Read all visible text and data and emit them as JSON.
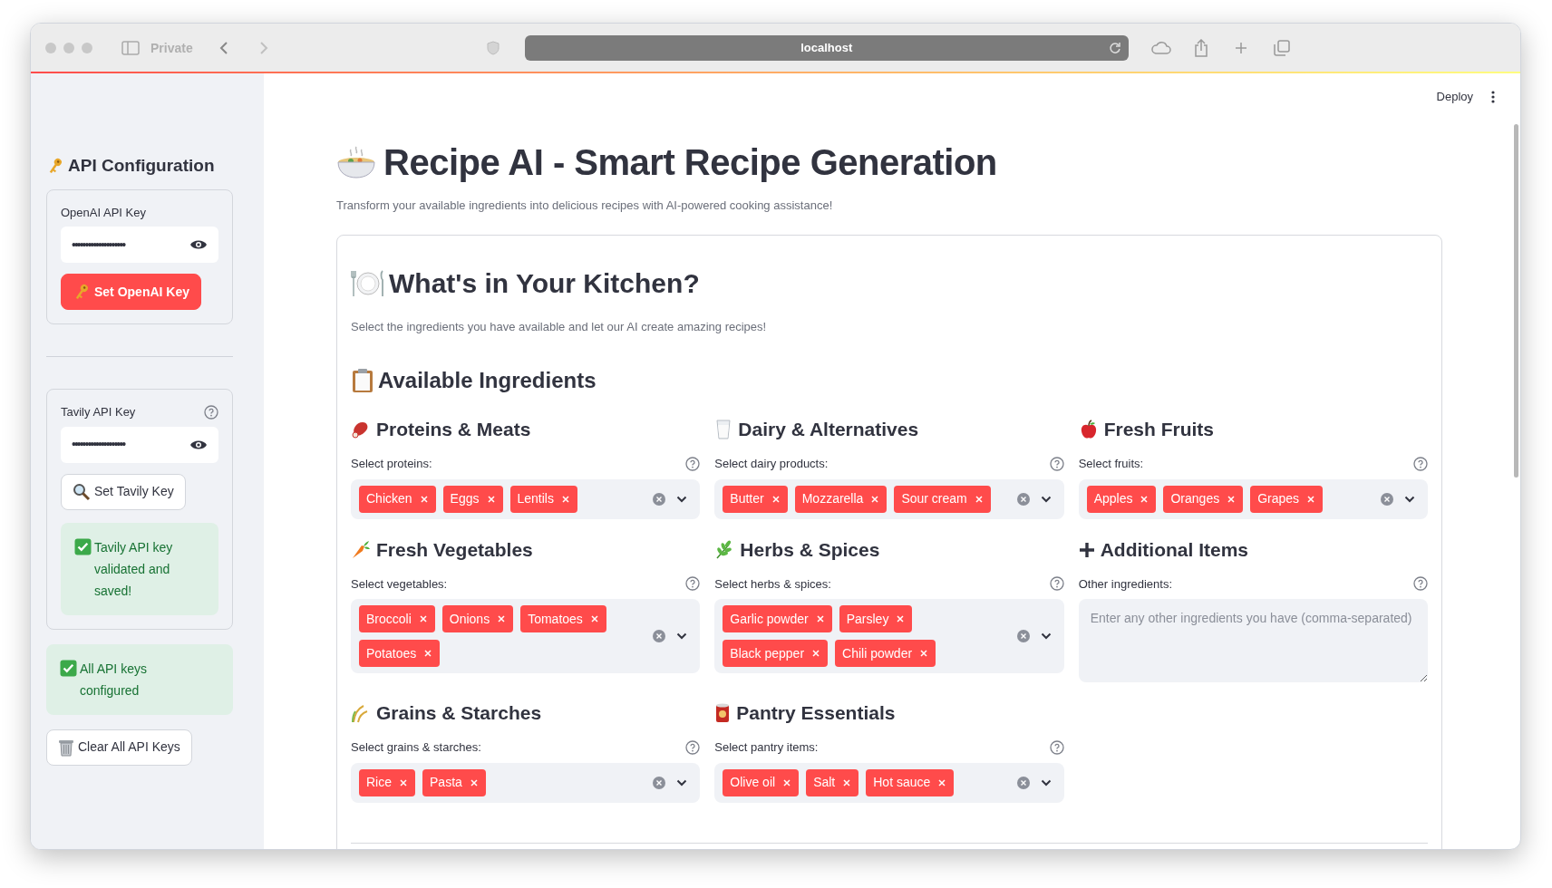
{
  "browser": {
    "private_label": "Private",
    "address": "localhost"
  },
  "sidebar": {
    "title": "API Configuration",
    "keys": [
      {
        "label": "OpenAI API Key",
        "value": "••••••••••••••••••••",
        "help": false,
        "button": "Set OpenAI Key",
        "primary": true
      },
      {
        "label": "Tavily API Key",
        "value": "••••••••••••••••••••",
        "help": true,
        "button": "Set Tavily Key",
        "primary": false,
        "message": "Tavily API key validated and saved!"
      }
    ],
    "status_message": "All API keys configured",
    "clear_button": "Clear All API Keys"
  },
  "header": {
    "deploy": "Deploy"
  },
  "title": "Recipe AI - Smart Recipe Generation",
  "subtitle": "Transform your available ingredients into delicious recipes with AI-powered cooking assistance!",
  "kitchen": {
    "title": "What's in Your Kitchen?",
    "description": "Select the ingredients you have available and let our AI create amazing recipes!",
    "section_title": "Available Ingredients",
    "categories": [
      {
        "title": "Proteins & Meats",
        "label": "Select proteins:",
        "kind": "multiselect",
        "tags": [
          "Chicken",
          "Eggs",
          "Lentils"
        ]
      },
      {
        "title": "Dairy & Alternatives",
        "label": "Select dairy products:",
        "kind": "multiselect",
        "tags": [
          "Butter",
          "Mozzarella",
          "Sour cream"
        ]
      },
      {
        "title": "Fresh Fruits",
        "label": "Select fruits:",
        "kind": "multiselect",
        "tags": [
          "Apples",
          "Oranges",
          "Grapes"
        ]
      },
      {
        "title": "Fresh Vegetables",
        "label": "Select vegetables:",
        "kind": "multiselect",
        "tags": [
          "Broccoli",
          "Onions",
          "Tomatoes",
          "Potatoes"
        ]
      },
      {
        "title": "Herbs & Spices",
        "label": "Select herbs & spices:",
        "kind": "multiselect",
        "tags": [
          "Garlic powder",
          "Parsley",
          "Black pepper",
          "Chili powder"
        ]
      },
      {
        "title": "Additional Items",
        "label": "Other ingredients:",
        "kind": "textarea",
        "placeholder": "Enter any other ingredients you have (comma-separated)"
      },
      {
        "title": "Grains & Starches",
        "label": "Select grains & starches:",
        "kind": "multiselect",
        "tags": [
          "Rice",
          "Pasta"
        ]
      },
      {
        "title": "Pantry Essentials",
        "label": "Select pantry items:",
        "kind": "multiselect",
        "tags": [
          "Olive oil",
          "Salt",
          "Hot sauce"
        ]
      }
    ]
  }
}
